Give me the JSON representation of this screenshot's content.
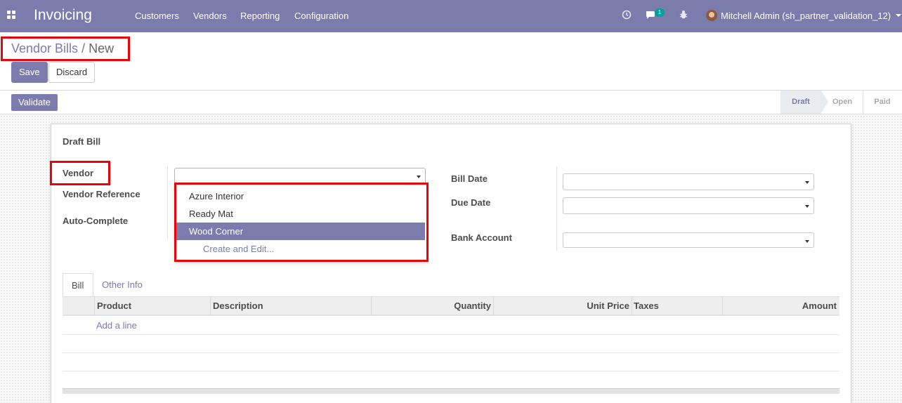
{
  "navbar": {
    "app_title": "Invoicing",
    "menu": [
      "Customers",
      "Vendors",
      "Reporting",
      "Configuration"
    ],
    "chat_badge": "1",
    "user": "Mitchell Admin (sh_partner_validation_12)",
    "icons": [
      "apps-icon",
      "clock-icon",
      "chat-icon",
      "bug-icon",
      "avatar",
      "caret-down-icon"
    ]
  },
  "breadcrumb": {
    "parent": "Vendor Bills",
    "separator": "/",
    "current": "New"
  },
  "buttons": {
    "save": "Save",
    "discard": "Discard",
    "validate": "Validate"
  },
  "status": {
    "stages": [
      "Draft",
      "Open",
      "Paid"
    ],
    "active": "Draft"
  },
  "form": {
    "title": "Draft Bill",
    "labels": {
      "vendor": "Vendor",
      "vendor_reference": "Vendor Reference",
      "auto_complete": "Auto-Complete",
      "bill_date": "Bill Date",
      "due_date": "Due Date",
      "bank_account": "Bank Account"
    },
    "vendor_value": "",
    "vendor_dropdown": {
      "options": [
        "Azure Interior",
        "Ready Mat",
        "Wood Corner"
      ],
      "selected": "Wood Corner",
      "create_label": "Create and Edit..."
    }
  },
  "tabs": [
    "Bill",
    "Other Info"
  ],
  "active_tab": "Bill",
  "table": {
    "columns": [
      "Product",
      "Description",
      "Quantity",
      "Unit Price",
      "Taxes",
      "Amount"
    ],
    "add_line": "Add a line"
  },
  "colors": {
    "brand": "#7c7bad",
    "highlight": "#e5050a",
    "badge": "#00a09d"
  }
}
